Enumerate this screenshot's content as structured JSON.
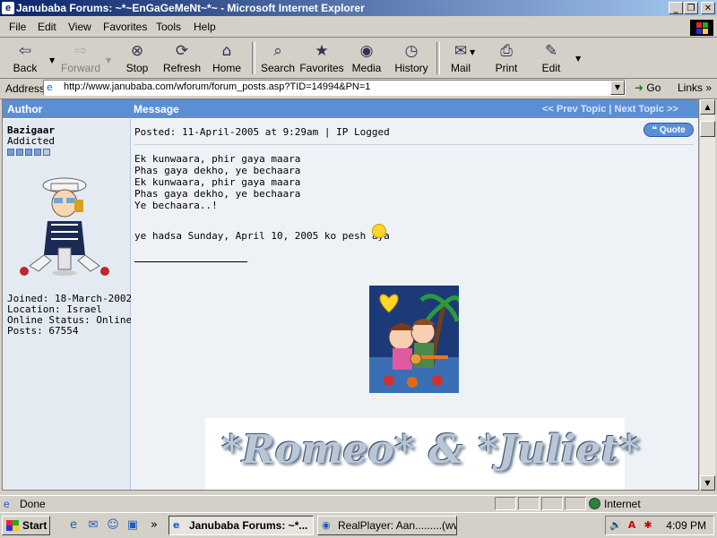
{
  "window": {
    "title": "Janubaba Forums: ~*~EnGaGeMeNt~*~ - Microsoft Internet Explorer",
    "min_label": "_",
    "max_label": "❐",
    "close_label": "✕"
  },
  "menu": [
    "File",
    "Edit",
    "View",
    "Favorites",
    "Tools",
    "Help"
  ],
  "toolbar": {
    "back": "Back",
    "forward": "Forward",
    "stop": "Stop",
    "refresh": "Refresh",
    "home": "Home",
    "search": "Search",
    "favorites": "Favorites",
    "media": "Media",
    "history": "History",
    "mail": "Mail",
    "print": "Print",
    "edit": "Edit"
  },
  "address": {
    "label": "Address",
    "url": "http://www.janubaba.com/wforum/forum_posts.asp?TID=14994&PN=1",
    "go": "Go",
    "links": "Links"
  },
  "forum": {
    "col_author": "Author",
    "col_message": "Message",
    "prev_topic": "<< Prev Topic",
    "nav_sep": "|",
    "next_topic": "Next Topic >>",
    "author": {
      "name": "Bazigaar",
      "rank": "Addicted",
      "rank_stars": 5,
      "info": "Joined: 18-March-2002\nLocation: Israel\nOnline Status: Online\nPosts: 67554"
    },
    "post": {
      "posted": "Posted: 11-April-2005 at 9:29am | IP Logged",
      "quote_label": "Quote",
      "lyrics": "Ek kunwaara, phir gaya maara\nPhas gaya dekho, ye bechaara\nEk kunwaara, phir gaya maara\nPhas gaya dekho, ye bechaara\nYe bechaara..!",
      "hadsa": "ye hadsa Sunday, April 10, 2005 ko pesh aya",
      "banner_text": "*Romeo*  & *Juliet*"
    }
  },
  "status": {
    "text": "Done",
    "zone": "Internet"
  },
  "taskbar": {
    "start": "Start",
    "tasks": [
      "Janubaba Forums: ~*...",
      "RealPlayer: Aan.........(ww..."
    ],
    "clock": "4:09 PM"
  }
}
